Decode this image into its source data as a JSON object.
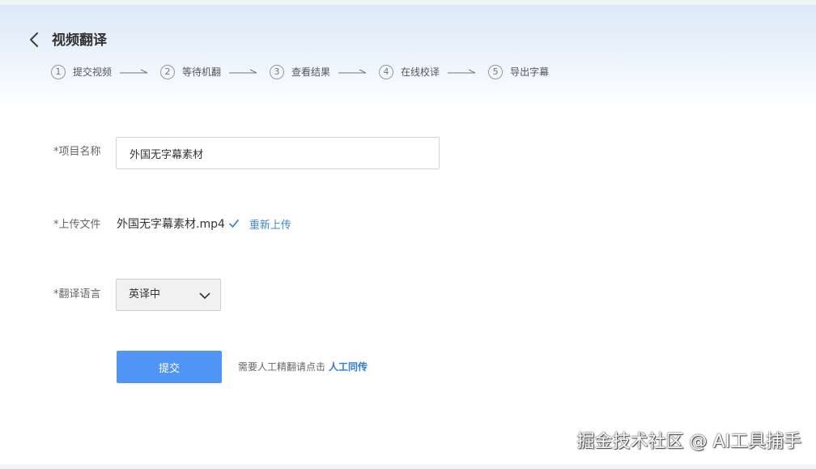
{
  "header": {
    "title": "视频翻译",
    "steps": [
      {
        "num": "1",
        "label": "提交视频"
      },
      {
        "num": "2",
        "label": "等待机翻"
      },
      {
        "num": "3",
        "label": "查看结果"
      },
      {
        "num": "4",
        "label": "在线校译"
      },
      {
        "num": "5",
        "label": "导出字幕"
      }
    ]
  },
  "form": {
    "project_name_label": "*项目名称",
    "project_name_value": "外国无字幕素材",
    "upload_label": "*上传文件",
    "file_name": "外国无字幕素材.mp4",
    "reupload_label": "重新上传",
    "language_label": "*翻译语言",
    "language_value": "英译中",
    "submit_label": "提交",
    "human_hint": "需要人工精翻请点击",
    "human_link": "人工同传"
  },
  "watermark": "掘金技术社区 @ AI工具捕手",
  "colors": {
    "accent": "#5095f5",
    "link": "#3f86d9"
  },
  "icons": {
    "back": "chevron-left-icon",
    "check": "check-icon",
    "dropdown": "chevron-down-icon"
  }
}
